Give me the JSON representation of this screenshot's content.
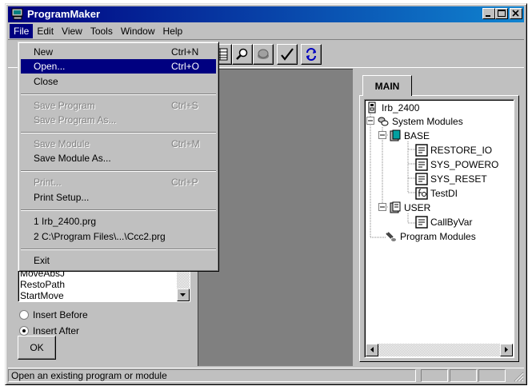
{
  "window": {
    "title": "ProgramMaker"
  },
  "menubar": {
    "items": [
      {
        "label": "File"
      },
      {
        "label": "Edit"
      },
      {
        "label": "View"
      },
      {
        "label": "Tools"
      },
      {
        "label": "Window"
      },
      {
        "label": "Help"
      }
    ]
  },
  "file_menu": {
    "items": [
      {
        "label": "New",
        "shortcut": "Ctrl+N",
        "enabled": true
      },
      {
        "label": "Open...",
        "shortcut": "Ctrl+O",
        "enabled": true,
        "highlighted": true
      },
      {
        "label": "Close",
        "shortcut": "",
        "enabled": true
      },
      {
        "label": "Save Program",
        "shortcut": "Ctrl+S",
        "enabled": false
      },
      {
        "label": "Save Program As...",
        "shortcut": "",
        "enabled": false
      },
      {
        "label": "Save Module",
        "shortcut": "Ctrl+M",
        "enabled": false
      },
      {
        "label": "Save Module As...",
        "shortcut": "",
        "enabled": true
      },
      {
        "label": "Print...",
        "shortcut": "Ctrl+P",
        "enabled": false
      },
      {
        "label": "Print Setup...",
        "shortcut": "",
        "enabled": true
      },
      {
        "label": "1 Irb_2400.prg",
        "shortcut": "",
        "enabled": true
      },
      {
        "label": "2 C:\\Program Files\\...\\Ccc2.prg",
        "shortcut": "",
        "enabled": true
      },
      {
        "label": "Exit",
        "shortcut": "",
        "enabled": true
      }
    ]
  },
  "toolbar": {
    "icons": [
      "table-icon",
      "search-icon",
      "record-icon",
      "check-icon",
      "refresh-icon"
    ]
  },
  "instruction_list": {
    "items": [
      "MoveAbsJ",
      "RestoPath",
      "StartMove"
    ]
  },
  "insert_options": {
    "before_label": "Insert Before",
    "after_label": "Insert After",
    "selected": "after"
  },
  "ok_button": {
    "label": "OK"
  },
  "main_tab": {
    "label": "MAIN"
  },
  "tree": {
    "root": "Irb_2400",
    "system_modules": "System Modules",
    "base": "BASE",
    "base_children": [
      "RESTORE_IO",
      "SYS_POWERO",
      "SYS_RESET",
      "TestDI"
    ],
    "user": "USER",
    "user_children": [
      "CallByVar"
    ],
    "program_modules": "Program Modules"
  },
  "statusbar": {
    "text": "Open an existing program or module"
  },
  "colors": {
    "title_bar": "#000080",
    "highlight": "#000080",
    "face": "#c0c0c0",
    "workspace": "#808080"
  }
}
